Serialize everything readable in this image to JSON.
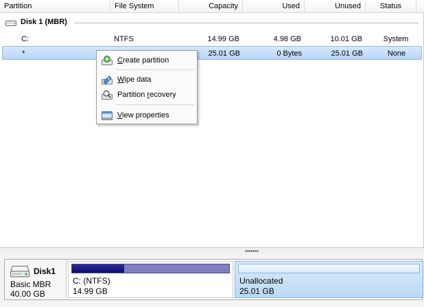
{
  "columns": {
    "partition": "Partition",
    "file_system": "File System",
    "capacity": "Capacity",
    "used": "Used",
    "unused": "Unused",
    "status": "Status"
  },
  "disk_group": {
    "label": "Disk 1 (MBR)"
  },
  "rows": [
    {
      "partition": "C:",
      "file_system": "NTFS",
      "capacity": "14.99 GB",
      "used": "4.98 GB",
      "unused": "10.01 GB",
      "status": "System",
      "selected": false
    },
    {
      "partition": "*",
      "file_system": "",
      "capacity": "25.01 GB",
      "used": "0 Bytes",
      "unused": "25.01 GB",
      "status": "None",
      "selected": true
    }
  ],
  "context_menu": {
    "items": [
      {
        "pre": "",
        "key": "C",
        "post": "reate partition",
        "icon": "create-partition-icon"
      },
      {
        "pre": "",
        "key": "W",
        "post": "ipe data",
        "icon": "wipe-data-icon"
      },
      {
        "pre": "Partition ",
        "key": "r",
        "post": "ecovery",
        "icon": "partition-recovery-icon"
      },
      {
        "pre": "",
        "key": "V",
        "post": "iew properties",
        "icon": "view-properties-icon"
      }
    ]
  },
  "disk_map": {
    "disk_name": "Disk1",
    "disk_type": "Basic MBR",
    "disk_size": "40.00 GB",
    "partitions": [
      {
        "name": "C: (NTFS)",
        "size": "14.99 GB",
        "used_fraction": 0.332
      },
      {
        "name": "Unallocated",
        "size": "25.01 GB",
        "used_fraction": 0
      }
    ]
  },
  "colors": {
    "selection": "#b9d6f6",
    "used_bar": "#0d0d6c",
    "unused_bar": "#8080c0",
    "unallocated": "#bcd9f5"
  }
}
